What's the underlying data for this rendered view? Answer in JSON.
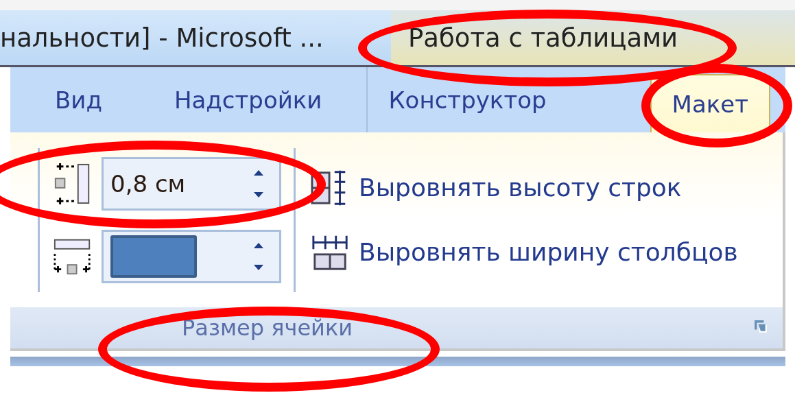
{
  "title_bar": {
    "document_title": "нальности] - Microsoft ...",
    "context_title": "Работа с таблицами"
  },
  "tabs": [
    {
      "label": "Вид",
      "selected": false
    },
    {
      "label": "Надстройки",
      "selected": false
    },
    {
      "label": "Конструктор",
      "selected": false
    },
    {
      "label": "Макет",
      "selected": true
    }
  ],
  "cell_size_group": {
    "height_field": {
      "value": "0,8 см"
    },
    "commands": [
      {
        "kind": "distribute-rows",
        "label": "Выровнять высоту строк"
      },
      {
        "kind": "distribute-columns",
        "label": "Выровнять ширину столбцов"
      }
    ],
    "group_label": "Размер ячейки"
  }
}
